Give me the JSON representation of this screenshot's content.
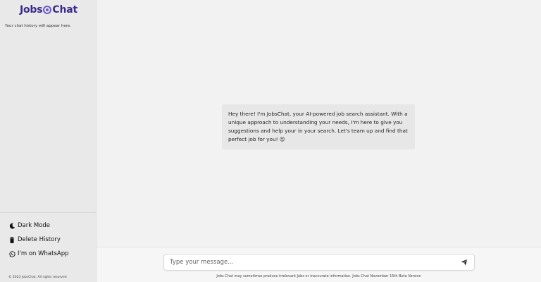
{
  "brand": {
    "name_part1": "Jobs",
    "name_part2": "Chat",
    "accent": "#3b2a8a"
  },
  "sidebar": {
    "history_note": "Your chat history will appear here.",
    "menu": [
      {
        "label": "Dark Mode",
        "icon": "moon-icon"
      },
      {
        "label": "Delete History",
        "icon": "trash-icon"
      },
      {
        "label": "I'm on WhatsApp",
        "icon": "whatsapp-icon"
      }
    ],
    "copyright": "© 2023 JobsChat. All rights reserved"
  },
  "chat": {
    "welcome_message": "Hey there! I'm JobsChat, your AI-powered job search assistant. With a unique approach to understanding your needs, I'm here to give you suggestions and help your in your search. Let's team up and find that perfect job for you! 😉"
  },
  "composer": {
    "placeholder": "Type your message...",
    "send_icon": "send-icon",
    "disclaimer": "Jobs Chat may sometimes produce irrelevant Jobs or inaccurate information. Jobs Chat November 15th Beta Version"
  }
}
